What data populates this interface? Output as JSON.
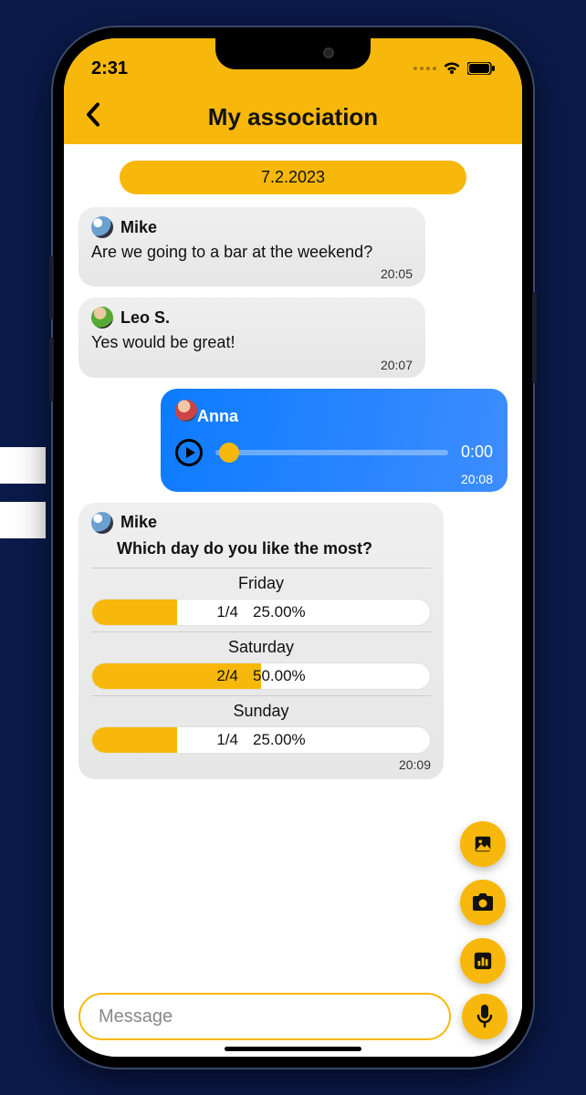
{
  "status": {
    "time": "2:31"
  },
  "header": {
    "title": "My association"
  },
  "date_separator": "7.2.2023",
  "messages": [
    {
      "sender": "Mike",
      "text": "Are we going to a bar at the weekend?",
      "time": "20:05"
    },
    {
      "sender": "Leo S.",
      "text": "Yes would be great!",
      "time": "20:07"
    }
  ],
  "voice": {
    "sender": "Anna",
    "duration": "0:00",
    "time": "20:08"
  },
  "poll": {
    "sender": "Mike",
    "question": "Which day do you like the most?",
    "time": "20:09",
    "options": [
      {
        "label": "Friday",
        "count": "1/4",
        "pct": "25.00%",
        "fill": 25
      },
      {
        "label": "Saturday",
        "count": "2/4",
        "pct": "50.00%",
        "fill": 50
      },
      {
        "label": "Sunday",
        "count": "1/4",
        "pct": "25.00%",
        "fill": 25
      }
    ]
  },
  "input": {
    "placeholder": "Message"
  }
}
